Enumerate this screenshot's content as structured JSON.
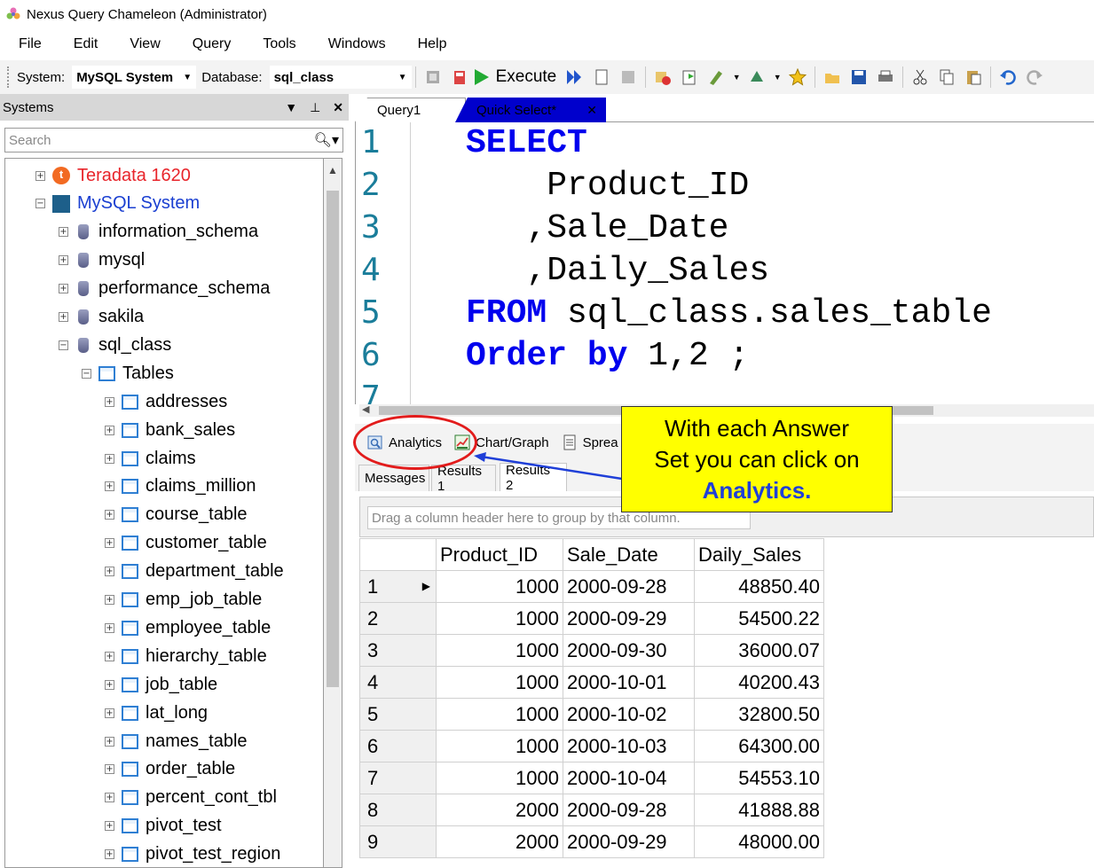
{
  "window": {
    "title": "Nexus Query Chameleon (Administrator)"
  },
  "menu": [
    "File",
    "Edit",
    "View",
    "Query",
    "Tools",
    "Windows",
    "Help"
  ],
  "toolbar": {
    "system_label": "System:",
    "system_value": "MySQL System",
    "database_label": "Database:",
    "database_value": "sql_class",
    "execute_label": "Execute"
  },
  "systems_panel": {
    "title": "Systems",
    "search_placeholder": "Search",
    "tree": [
      {
        "label": "Teradata 1620",
        "level": 0,
        "expander": "+",
        "icon": "teradata-icon",
        "color": "#e8242a"
      },
      {
        "label": "MySQL System",
        "level": 0,
        "expander": "−",
        "icon": "mysql-icon",
        "color": "#1a3fd1"
      },
      {
        "label": "information_schema",
        "level": 1,
        "expander": "+",
        "icon": "database-icon"
      },
      {
        "label": "mysql",
        "level": 1,
        "expander": "+",
        "icon": "database-icon"
      },
      {
        "label": "performance_schema",
        "level": 1,
        "expander": "+",
        "icon": "database-icon"
      },
      {
        "label": "sakila",
        "level": 1,
        "expander": "+",
        "icon": "database-icon"
      },
      {
        "label": "sql_class",
        "level": 1,
        "expander": "−",
        "icon": "database-icon"
      },
      {
        "label": "Tables",
        "level": 2,
        "expander": "−",
        "icon": "table-icon"
      },
      {
        "label": "addresses",
        "level": 3,
        "expander": "+",
        "icon": "table-icon"
      },
      {
        "label": "bank_sales",
        "level": 3,
        "expander": "+",
        "icon": "table-icon"
      },
      {
        "label": "claims",
        "level": 3,
        "expander": "+",
        "icon": "table-icon"
      },
      {
        "label": "claims_million",
        "level": 3,
        "expander": "+",
        "icon": "table-icon"
      },
      {
        "label": "course_table",
        "level": 3,
        "expander": "+",
        "icon": "table-icon"
      },
      {
        "label": "customer_table",
        "level": 3,
        "expander": "+",
        "icon": "table-icon"
      },
      {
        "label": "department_table",
        "level": 3,
        "expander": "+",
        "icon": "table-icon"
      },
      {
        "label": "emp_job_table",
        "level": 3,
        "expander": "+",
        "icon": "table-icon"
      },
      {
        "label": "employee_table",
        "level": 3,
        "expander": "+",
        "icon": "table-icon"
      },
      {
        "label": "hierarchy_table",
        "level": 3,
        "expander": "+",
        "icon": "table-icon"
      },
      {
        "label": "job_table",
        "level": 3,
        "expander": "+",
        "icon": "table-icon"
      },
      {
        "label": "lat_long",
        "level": 3,
        "expander": "+",
        "icon": "table-icon"
      },
      {
        "label": "names_table",
        "level": 3,
        "expander": "+",
        "icon": "table-icon"
      },
      {
        "label": "order_table",
        "level": 3,
        "expander": "+",
        "icon": "table-icon"
      },
      {
        "label": "percent_cont_tbl",
        "level": 3,
        "expander": "+",
        "icon": "table-icon"
      },
      {
        "label": "pivot_test",
        "level": 3,
        "expander": "+",
        "icon": "table-icon"
      },
      {
        "label": "pivot_test_region",
        "level": 3,
        "expander": "+",
        "icon": "table-icon"
      }
    ]
  },
  "editor": {
    "tabs": [
      {
        "label": "Query1"
      },
      {
        "label": "Quick Select*"
      }
    ],
    "line_numbers": [
      "1",
      "2",
      "3",
      "4",
      "5",
      "6",
      "7"
    ],
    "code": [
      {
        "kw": "SELECT",
        "rest": ""
      },
      {
        "kw": "",
        "rest": "    Product_ID"
      },
      {
        "kw": "",
        "rest": "   ,Sale_Date"
      },
      {
        "kw": "",
        "rest": "   ,Daily_Sales"
      },
      {
        "kw": "FROM",
        "rest": " sql_class.sales_table"
      },
      {
        "kw": "Order by",
        "rest": " 1,2 ;"
      }
    ]
  },
  "analytics_bar": {
    "analytics": "Analytics",
    "chart": "Chart/Graph",
    "spreadsheet": "Sprea"
  },
  "result_tabs": [
    "Messages",
    "Results 1",
    "Results 2"
  ],
  "group_hint": "Drag a column header here to group by that column.",
  "grid": {
    "columns": [
      "Product_ID",
      "Sale_Date",
      "Daily_Sales"
    ],
    "rows": [
      [
        "1",
        "1000",
        "2000-09-28",
        "48850.40"
      ],
      [
        "2",
        "1000",
        "2000-09-29",
        "54500.22"
      ],
      [
        "3",
        "1000",
        "2000-09-30",
        "36000.07"
      ],
      [
        "4",
        "1000",
        "2000-10-01",
        "40200.43"
      ],
      [
        "5",
        "1000",
        "2000-10-02",
        "32800.50"
      ],
      [
        "6",
        "1000",
        "2000-10-03",
        "64300.00"
      ],
      [
        "7",
        "1000",
        "2000-10-04",
        "54553.10"
      ],
      [
        "8",
        "2000",
        "2000-09-28",
        "41888.88"
      ],
      [
        "9",
        "2000",
        "2000-09-29",
        "48000.00"
      ]
    ]
  },
  "callout": {
    "line1": "With each Answer",
    "line2": "Set you can click on",
    "highlight": "Analytics."
  }
}
